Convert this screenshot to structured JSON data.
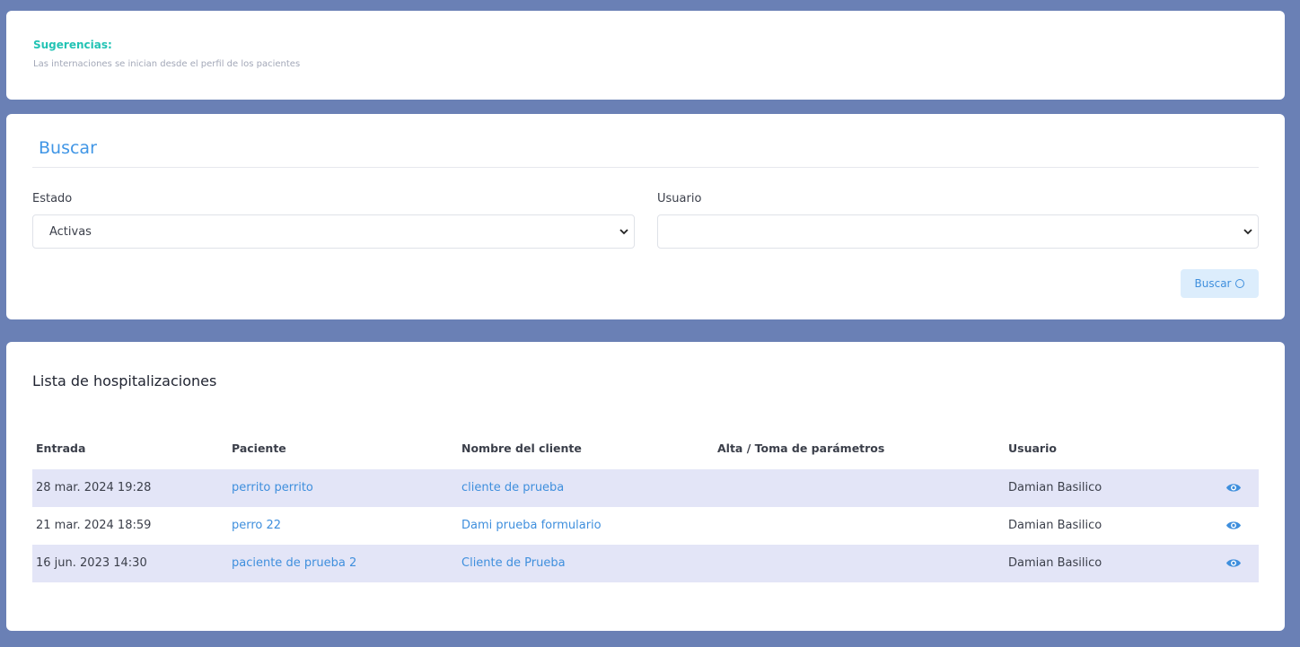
{
  "suggestions": {
    "title": "Sugerencias:",
    "text": "Las internaciones se inician desde el perfil de los pacientes"
  },
  "search": {
    "title": "Buscar",
    "estado_label": "Estado",
    "estado_value": "Activas",
    "usuario_label": "Usuario",
    "usuario_value": "",
    "button_label": "Buscar"
  },
  "list": {
    "title": "Lista de hospitalizaciones",
    "columns": [
      "Entrada",
      "Paciente",
      "Nombre del cliente",
      "Alta / Toma de parámetros",
      "Usuario"
    ],
    "rows": [
      {
        "entrada": "28 mar. 2024 19:28",
        "paciente": "perrito perrito",
        "cliente": "cliente de prueba",
        "alta": "",
        "usuario": "Damian Basilico"
      },
      {
        "entrada": "21 mar. 2024 18:59",
        "paciente": "perro 22",
        "cliente": "Dami prueba formulario",
        "alta": "",
        "usuario": "Damian Basilico"
      },
      {
        "entrada": "16 jun. 2023 14:30",
        "paciente": "paciente de prueba 2",
        "cliente": "Cliente de Prueba",
        "alta": "",
        "usuario": "Damian Basilico"
      }
    ]
  },
  "colors": {
    "background": "#6a80b5",
    "accent": "#4096e6",
    "suggestion": "#22c3b4",
    "row_shade": "#e3e5f7"
  },
  "icons": [
    "chevron-down-icon",
    "search-icon",
    "eye-icon"
  ]
}
